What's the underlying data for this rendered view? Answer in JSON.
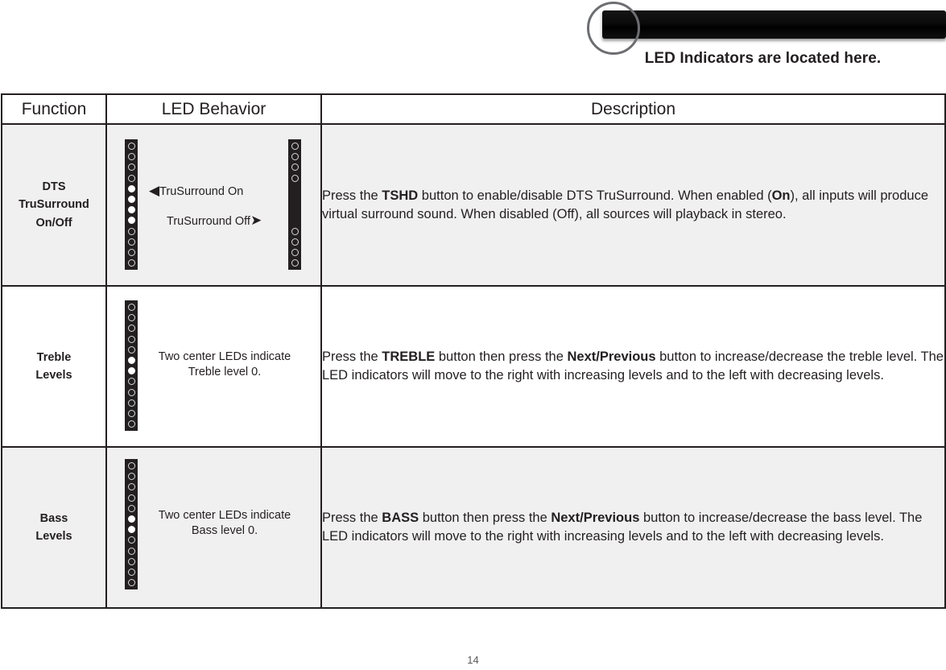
{
  "illustration": {
    "caption": "LED Indicators are located here.",
    "circle_icon": "callout-circle",
    "device_icon": "soundbar"
  },
  "table": {
    "headers": [
      "Function",
      "LED Behavior",
      "Description"
    ],
    "rows": [
      {
        "function": "DTS\nTruSurround\nOn/Off",
        "function_lines": [
          "DTS",
          "TruSurround",
          "On/Off"
        ],
        "behavior": {
          "type": "two-strips",
          "left_strip": {
            "name": "trusurround-on-strip",
            "leds": [
              "off",
              "off",
              "off",
              "off",
              "on",
              "on",
              "on",
              "on",
              "off",
              "off",
              "off",
              "off"
            ]
          },
          "right_strip": {
            "name": "trusurround-off-strip",
            "leds": [
              "off",
              "off",
              "off",
              "off",
              "blank",
              "blank",
              "blank",
              "blank",
              "off",
              "off",
              "off",
              "off"
            ]
          },
          "label_on": "TruSurround On",
          "label_on_arrow": "◀",
          "label_off": "TruSurround Off",
          "label_off_arrow": "➤"
        },
        "description": {
          "segments": [
            {
              "text": "Press the ",
              "bold": false
            },
            {
              "text": "TSHD",
              "bold": true
            },
            {
              "text": " button to enable/disable DTS TruSurround. When enabled (",
              "bold": false
            },
            {
              "text": "On",
              "bold": true
            },
            {
              "text": "), all inputs will produce virtual surround sound. When disabled (Off), all sources will playback in stereo.",
              "bold": false
            }
          ]
        }
      },
      {
        "function": "Treble\nLevels",
        "function_lines": [
          "Treble",
          "Levels"
        ],
        "behavior": {
          "type": "one-strip",
          "strip": {
            "name": "treble-level-strip",
            "leds": [
              "off",
              "off",
              "off",
              "off",
              "off",
              "on",
              "on",
              "off",
              "off",
              "off",
              "off",
              "off"
            ]
          },
          "note_lines": [
            "Two center LEDs indicate",
            "Treble level 0."
          ]
        },
        "description": {
          "segments": [
            {
              "text": "Press the ",
              "bold": false
            },
            {
              "text": "TREBLE",
              "bold": true
            },
            {
              "text": " button then press the ",
              "bold": false
            },
            {
              "text": "Next/Previous",
              "bold": true
            },
            {
              "text": " button to increase/decrease the treble level. The LED indicators will move to the right with increasing levels and to the left with decreasing levels.",
              "bold": false
            }
          ]
        }
      },
      {
        "function": "Bass\nLevels",
        "function_lines": [
          "Bass",
          "Levels"
        ],
        "behavior": {
          "type": "one-strip",
          "strip": {
            "name": "bass-level-strip",
            "leds": [
              "off",
              "off",
              "off",
              "off",
              "off",
              "on",
              "on",
              "off",
              "off",
              "off",
              "off",
              "off"
            ]
          },
          "note_lines": [
            "Two center LEDs indicate",
            "Bass level 0."
          ]
        },
        "description": {
          "segments": [
            {
              "text": "Press the ",
              "bold": false
            },
            {
              "text": "BASS",
              "bold": true
            },
            {
              "text": " button then press the ",
              "bold": false
            },
            {
              "text": "Next/Previous",
              "bold": true
            },
            {
              "text": " button to increase/decrease the bass level. The LED indicators will move to the right with increasing levels and to the left with decreasing levels.",
              "bold": false
            }
          ]
        }
      }
    ]
  },
  "footer": {
    "page_number": "14"
  },
  "colors": {
    "text": "#231f20",
    "shaded_row": "#f0f0f0",
    "strip_body": "#231f20",
    "led_on": "#ffffff",
    "led_off_ring": "#d9d9d9",
    "callout_stroke": "#6d6e71"
  }
}
